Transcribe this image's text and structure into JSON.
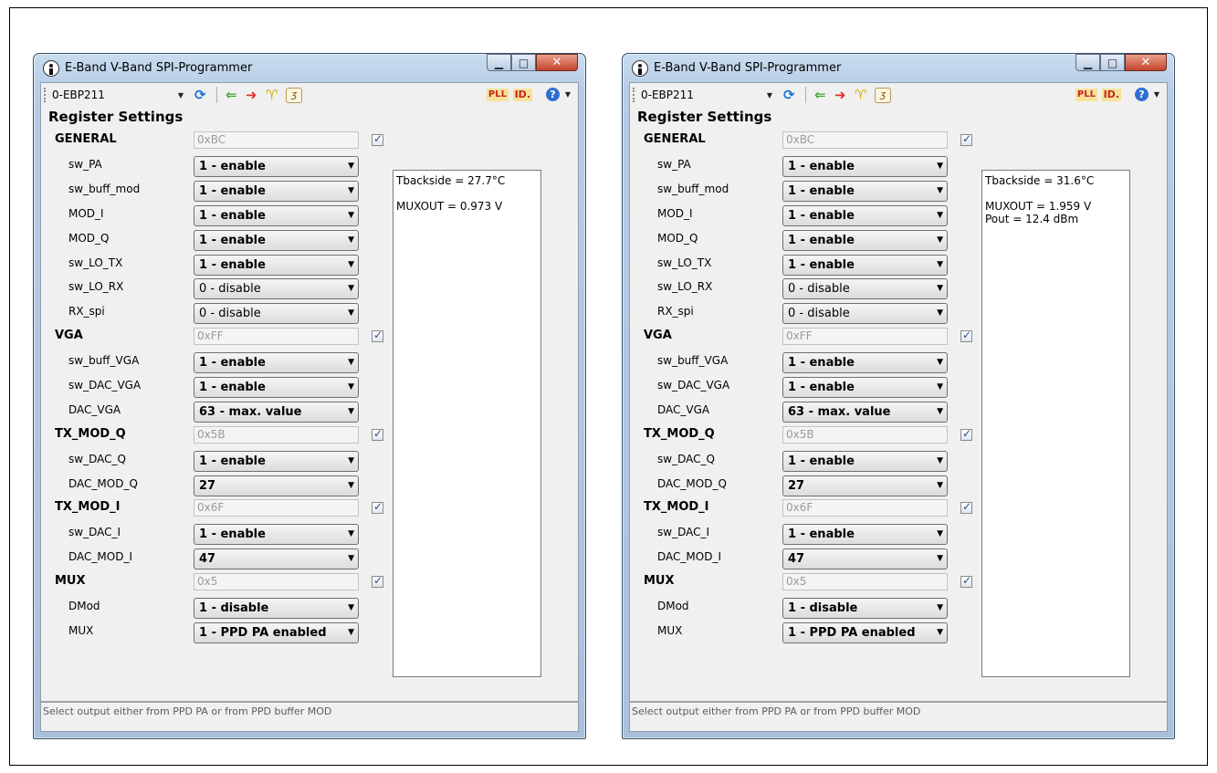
{
  "windows": [
    {
      "title": "E-Band V-Band SPI-Programmer",
      "device": "0-EBP211",
      "toolbar_pll": "PLL",
      "toolbar_id": "ID.",
      "heading": "Register Settings",
      "groups": [
        {
          "name": "GENERAL",
          "hex": "0xBC",
          "checked": true,
          "fields": [
            {
              "label": "sw_PA",
              "value": "1 - enable",
              "bold": true
            },
            {
              "label": "sw_buff_mod",
              "value": "1 - enable",
              "bold": true
            },
            {
              "label": "MOD_I",
              "value": "1 - enable",
              "bold": true
            },
            {
              "label": "MOD_Q",
              "value": "1 - enable",
              "bold": true
            },
            {
              "label": "sw_LO_TX",
              "value": "1 - enable",
              "bold": true
            },
            {
              "label": "sw_LO_RX",
              "value": "0 - disable",
              "bold": false
            },
            {
              "label": "RX_spi",
              "value": "0 - disable",
              "bold": false
            }
          ]
        },
        {
          "name": "VGA",
          "hex": "0xFF",
          "checked": true,
          "fields": [
            {
              "label": "sw_buff_VGA",
              "value": "1 - enable",
              "bold": true
            },
            {
              "label": "sw_DAC_VGA",
              "value": "1 - enable",
              "bold": true
            },
            {
              "label": "DAC_VGA",
              "value": "63 - max. value",
              "bold": true
            }
          ]
        },
        {
          "name": "TX_MOD_Q",
          "hex": "0x5B",
          "checked": true,
          "fields": [
            {
              "label": "sw_DAC_Q",
              "value": "1 - enable",
              "bold": true
            },
            {
              "label": "DAC_MOD_Q",
              "value": "27",
              "bold": true
            }
          ]
        },
        {
          "name": "TX_MOD_I",
          "hex": "0x6F",
          "checked": true,
          "fields": [
            {
              "label": "sw_DAC_I",
              "value": "1 - enable",
              "bold": true
            },
            {
              "label": "DAC_MOD_I",
              "value": "47",
              "bold": true
            }
          ]
        },
        {
          "name": "MUX",
          "hex": "0x5",
          "checked": true,
          "fields": [
            {
              "label": "DMod",
              "value": "1 - disable",
              "bold": true
            },
            {
              "label": "MUX",
              "value": "1 - PPD PA enabled",
              "bold": true
            }
          ]
        }
      ],
      "output_lines": [
        "Tbackside = 27.7°C",
        "",
        "MUXOUT = 0.973 V"
      ],
      "status": "Select output either from PPD PA or from PPD buffer MOD"
    },
    {
      "title": "E-Band V-Band SPI-Programmer",
      "device": "0-EBP211",
      "toolbar_pll": "PLL",
      "toolbar_id": "ID.",
      "heading": "Register Settings",
      "groups": [
        {
          "name": "GENERAL",
          "hex": "0xBC",
          "checked": true,
          "fields": [
            {
              "label": "sw_PA",
              "value": "1 - enable",
              "bold": true
            },
            {
              "label": "sw_buff_mod",
              "value": "1 - enable",
              "bold": true
            },
            {
              "label": "MOD_I",
              "value": "1 - enable",
              "bold": true
            },
            {
              "label": "MOD_Q",
              "value": "1 - enable",
              "bold": true
            },
            {
              "label": "sw_LO_TX",
              "value": "1 - enable",
              "bold": true
            },
            {
              "label": "sw_LO_RX",
              "value": "0 - disable",
              "bold": false
            },
            {
              "label": "RX_spi",
              "value": "0 - disable",
              "bold": false
            }
          ]
        },
        {
          "name": "VGA",
          "hex": "0xFF",
          "checked": true,
          "fields": [
            {
              "label": "sw_buff_VGA",
              "value": "1 - enable",
              "bold": true
            },
            {
              "label": "sw_DAC_VGA",
              "value": "1 - enable",
              "bold": true
            },
            {
              "label": "DAC_VGA",
              "value": "63 - max. value",
              "bold": true
            }
          ]
        },
        {
          "name": "TX_MOD_Q",
          "hex": "0x5B",
          "checked": true,
          "fields": [
            {
              "label": "sw_DAC_Q",
              "value": "1 - enable",
              "bold": true
            },
            {
              "label": "DAC_MOD_Q",
              "value": "27",
              "bold": true
            }
          ]
        },
        {
          "name": "TX_MOD_I",
          "hex": "0x6F",
          "checked": true,
          "fields": [
            {
              "label": "sw_DAC_I",
              "value": "1 - enable",
              "bold": true
            },
            {
              "label": "DAC_MOD_I",
              "value": "47",
              "bold": true
            }
          ]
        },
        {
          "name": "MUX",
          "hex": "0x5",
          "checked": true,
          "fields": [
            {
              "label": "DMod",
              "value": "1 - disable",
              "bold": true
            },
            {
              "label": "MUX",
              "value": "1 - PPD PA enabled",
              "bold": true
            }
          ]
        }
      ],
      "output_lines": [
        "Tbackside = 31.6°C",
        "",
        "MUXOUT = 1.959 V",
        "Pout = 12.4 dBm"
      ],
      "status": "Select output either from PPD PA or from PPD buffer MOD"
    }
  ]
}
